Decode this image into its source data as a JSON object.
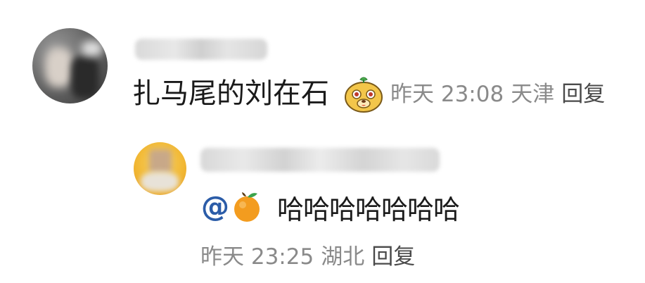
{
  "comment": {
    "username": "",
    "text": "扎马尾的刘在石",
    "sticker_icon": "cute-dog-face-sticker",
    "time": "昨天 23:08",
    "location": "天津",
    "reply_label": "回复"
  },
  "reply": {
    "username": "",
    "mention": "@",
    "mention_icon": "tangerine-emoji",
    "text": "哈哈哈哈哈哈哈",
    "time": "昨天 23:25",
    "location": "湖北",
    "reply_label": "回复"
  }
}
